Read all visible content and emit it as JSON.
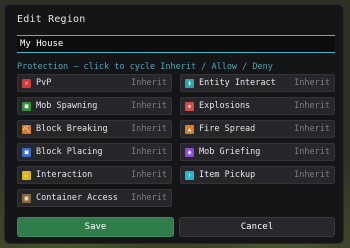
{
  "dialog": {
    "title": "Edit Region",
    "name_value": "My House",
    "hint": "Protection — click to cycle Inherit / Allow / Deny"
  },
  "flags_left": [
    {
      "label": "PvP",
      "state": "Inherit",
      "icon": "pvp-icon",
      "color": "#d23c3c"
    },
    {
      "label": "Mob Spawning",
      "state": "Inherit",
      "icon": "mob-spawning-icon",
      "color": "#3a8f3a"
    },
    {
      "label": "Block Breaking",
      "state": "Inherit",
      "icon": "block-breaking-icon",
      "color": "#d27a2a"
    },
    {
      "label": "Block Placing",
      "state": "Inherit",
      "icon": "block-placing-icon",
      "color": "#3a6ad2"
    },
    {
      "label": "Interaction",
      "state": "Inherit",
      "icon": "interaction-icon",
      "color": "#d2b82a"
    },
    {
      "label": "Container Access",
      "state": "Inherit",
      "icon": "container-access-icon",
      "color": "#8a6a3a"
    }
  ],
  "flags_right": [
    {
      "label": "Entity Interact",
      "state": "Inherit",
      "icon": "entity-interact-icon",
      "color": "#2aa8a8"
    },
    {
      "label": "Explosions",
      "state": "Inherit",
      "icon": "explosions-icon",
      "color": "#d24a4a"
    },
    {
      "label": "Fire Spread",
      "state": "Inherit",
      "icon": "fire-spread-icon",
      "color": "#e07a1a"
    },
    {
      "label": "Mob Griefing",
      "state": "Inherit",
      "icon": "mob-griefing-icon",
      "color": "#8a4ad2"
    },
    {
      "label": "Item Pickup",
      "state": "Inherit",
      "icon": "item-pickup-icon",
      "color": "#2ab8c8"
    }
  ],
  "buttons": {
    "save": "Save",
    "cancel": "Cancel"
  },
  "colors": {
    "accent": "#3fb8c8",
    "save_bg": "#2e7d4a"
  }
}
